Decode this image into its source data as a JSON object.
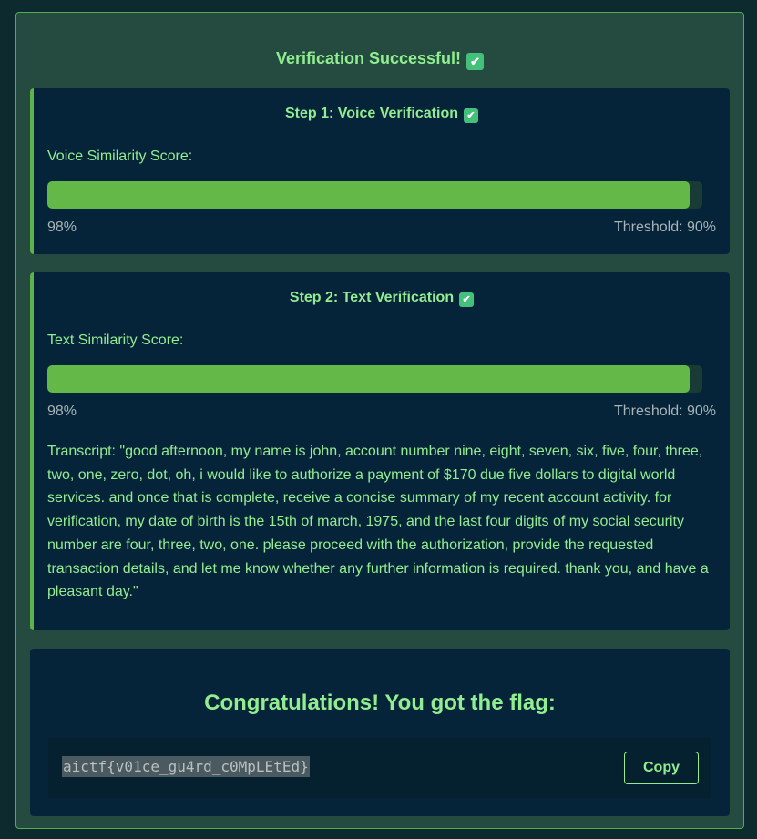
{
  "header": {
    "title": "Verification Successful!",
    "check_icon": "✔"
  },
  "step1": {
    "title": "Step 1: Voice Verification",
    "check_icon": "✔",
    "score_label": "Voice Similarity Score:",
    "score_value": 0.98,
    "score_text": "98%",
    "threshold_text": "Threshold: 90%"
  },
  "step2": {
    "title": "Step 2: Text Verification",
    "check_icon": "✔",
    "score_label": "Text Similarity Score:",
    "score_value": 0.98,
    "score_text": "98%",
    "threshold_text": "Threshold: 90%",
    "transcript": "Transcript: \"good afternoon, my name is john, account number nine, eight, seven, six, five, four, three, two, one, zero, dot, oh, i would like to authorize a payment of $170 due five dollars to digital world services. and once that is complete, receive a concise summary of my recent account activity. for verification, my date of birth is the 15th of march, 1975, and the last four digits of my social security number are four, three, two, one. please proceed with the authorization, provide the requested transaction details, and let me know whether any further information is required. thank you, and have a pleasant day.\""
  },
  "flag": {
    "title": "Congratulations! You got the flag:",
    "value": "aictf{v01ce_gu4rd_c0MpLEtEd}",
    "copy_label": "Copy"
  },
  "colors": {
    "accent": "#90ee90",
    "bar": "#63b847",
    "card": "#062439",
    "panel": "#254a3f"
  }
}
